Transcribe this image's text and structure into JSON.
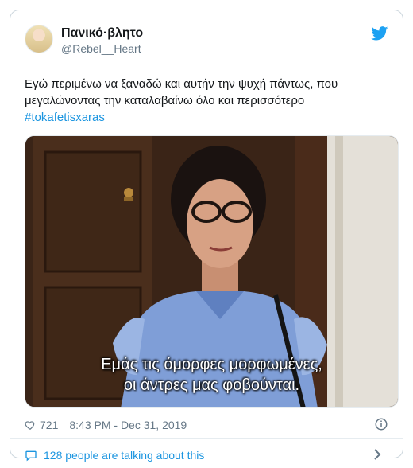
{
  "user": {
    "display_name": "Πανικό·βλητο",
    "handle": "@Rebel__Heart"
  },
  "tweet": {
    "text_line1": "Εγώ περιμένω να ξαναδώ και αυτήν την ψυχή πάντως, που",
    "text_line2": "μεγαλώνοντας την καταλαβαίνω όλο και περισσότερο",
    "hashtag": "#tokafetisxaras",
    "media_subtitle_line1": "Εμάς τις όμορφες μορφωμένες,",
    "media_subtitle_line2": "οι άντρες μας φοβούνται."
  },
  "meta": {
    "likes": "721",
    "timestamp": "8:43 PM - Dec 31, 2019"
  },
  "footer": {
    "talking": "128 people are talking about this"
  },
  "icons": {
    "brand": "twitter-bird-icon",
    "like": "heart-icon",
    "info": "info-icon",
    "reply": "speech-bubble-icon",
    "more": "chevron-right-icon"
  },
  "colors": {
    "accent": "#1b95e0",
    "text": "#14171a",
    "muted": "#657786",
    "border": "#ccd6dd"
  }
}
